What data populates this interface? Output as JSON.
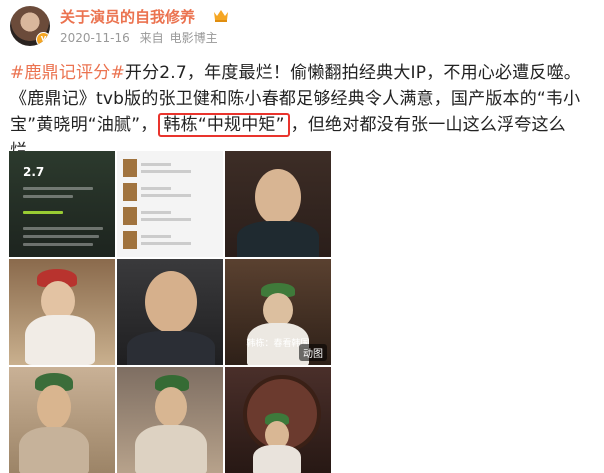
{
  "header": {
    "username": "关于演员的自我修养",
    "date": "2020-11-16",
    "source_prefix": "来自",
    "source": "电影博主"
  },
  "post": {
    "hashtag": "#鹿鼎记评分#",
    "line1_rest": "开分2.7，年度最烂！偷懒翻拍经典大IP，不用心必遭反噬。",
    "line2": "《鹿鼎记》tvb版的张卫健和陈小春都足够经典令人满意，国产版本的“韦小宝”黄晓明“油腻”，",
    "highlight": "韩栋“中规中矩”",
    "line3_rest": "，但绝对都没有张一山这么浮夸这么烂。"
  },
  "images": {
    "score": "2.7",
    "caption": "韩栋：春看韩国",
    "gif_label": "动图"
  },
  "colors": {
    "accent": "#eb7350",
    "highlight_border": "#e9342d"
  }
}
